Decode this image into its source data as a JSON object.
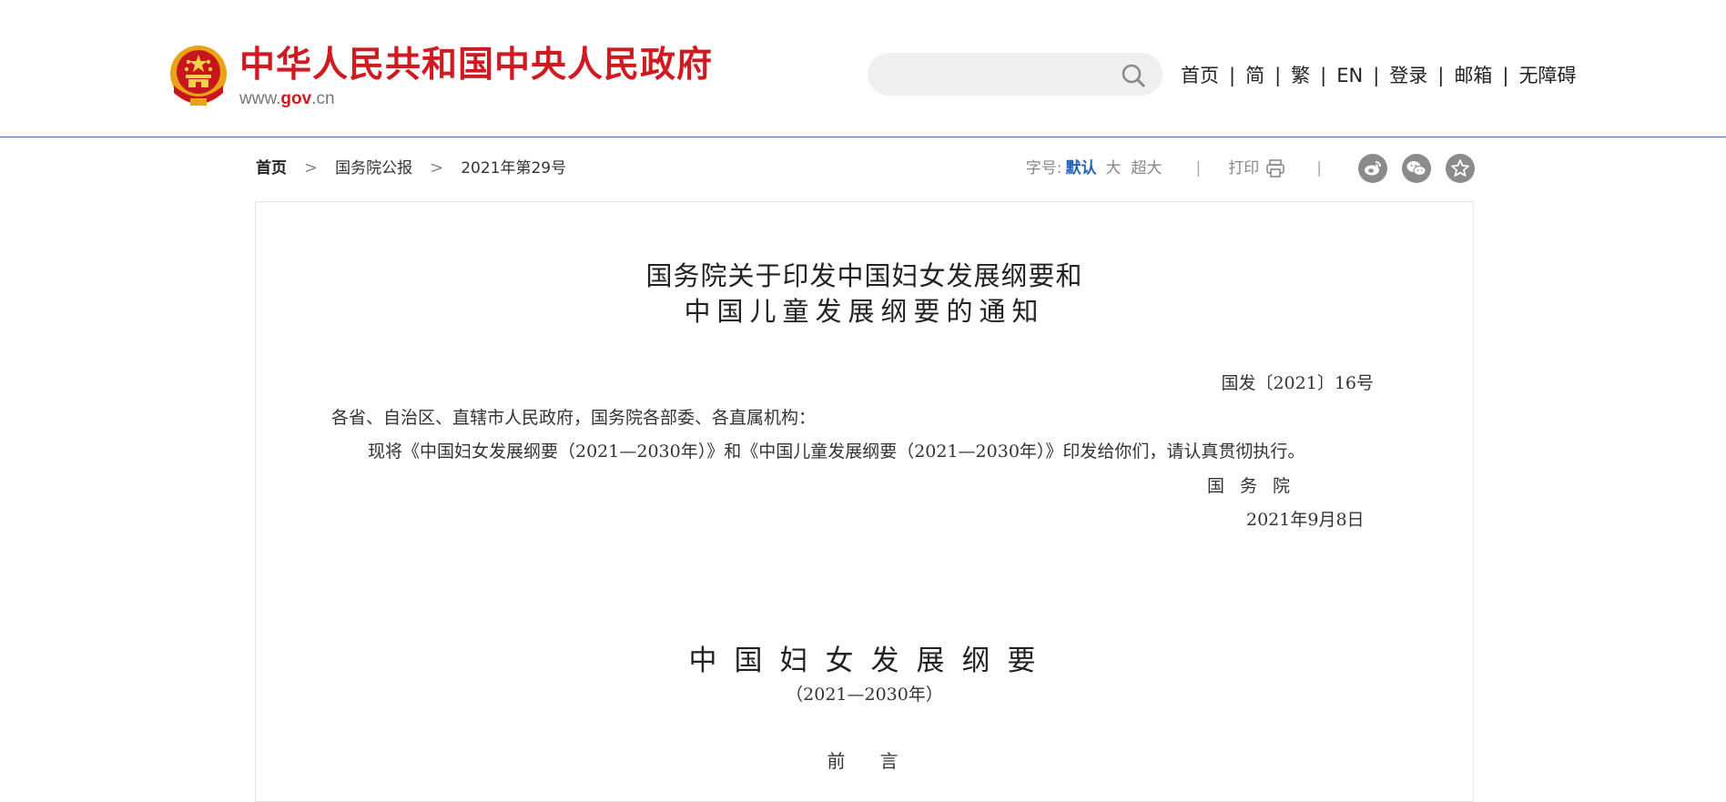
{
  "header": {
    "site_title": "中华人民共和国中央人民政府",
    "site_url_prefix": "www.",
    "site_url_domain": "gov",
    "site_url_suffix": ".cn",
    "search": {
      "placeholder": "",
      "icon": "search-icon"
    },
    "nav": [
      {
        "label": "首页"
      },
      {
        "label": "简"
      },
      {
        "label": "繁"
      },
      {
        "label": "EN"
      },
      {
        "label": "登录"
      },
      {
        "label": "邮箱"
      },
      {
        "label": "无障碍"
      }
    ],
    "nav_separator": "|"
  },
  "breadcrumb": {
    "items": [
      {
        "label": "首页"
      },
      {
        "label": "国务院公报"
      },
      {
        "label": "2021年第29号"
      }
    ],
    "separator": ">"
  },
  "tools": {
    "font_size_label": "字号:",
    "font_size_default": "默认",
    "font_size_large": "大",
    "font_size_xlarge": "超大",
    "separator": "|",
    "print_label": "打印",
    "share_icons": [
      "weibo-icon",
      "wechat-icon",
      "favorite-icon"
    ]
  },
  "article": {
    "title_line1": "国务院关于印发中国妇女发展纲要和",
    "title_line2": "中国儿童发展纲要的通知",
    "doc_number": "国发〔2021〕16号",
    "addressee": "各省、自治区、直辖市人民政府，国务院各部委、各直属机构：",
    "body": "现将《中国妇女发展纲要（2021—2030年）》和《中国儿童发展纲要（2021—2030年）》印发给你们，请认真贯彻执行。",
    "issuer": "国务院",
    "date": "2021年9月8日",
    "outline_title": "中国妇女发展纲要",
    "outline_period": "（2021—2030年）",
    "preface_heading": "前言"
  },
  "colors": {
    "brand_red": "#d01a21",
    "link_blue": "#1f62b5",
    "header_rule": "#4c6f9e",
    "share_gray": "#8b8b8b"
  }
}
